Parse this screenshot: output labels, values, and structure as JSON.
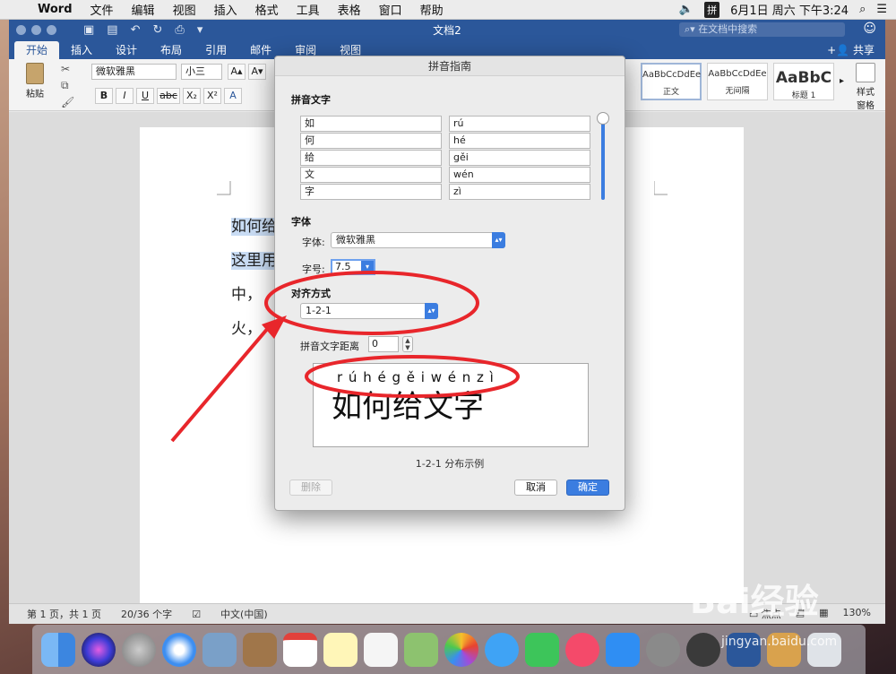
{
  "menubar": {
    "app": "Word",
    "items": [
      "文件",
      "编辑",
      "视图",
      "插入",
      "格式",
      "工具",
      "表格",
      "窗口",
      "帮助"
    ],
    "ime": "拼",
    "clock": "6月1日 周六 下午3:24"
  },
  "window": {
    "title": "文档2",
    "search_placeholder": "在文档中搜索",
    "share": "共享"
  },
  "tabs": [
    "开始",
    "插入",
    "设计",
    "布局",
    "引用",
    "邮件",
    "审阅",
    "视图"
  ],
  "ribbon": {
    "paste": "粘贴",
    "font": "微软雅黑",
    "size": "小三",
    "format_buttons": [
      "B",
      "I",
      "U",
      "abc",
      "X₂",
      "X²"
    ],
    "styles": [
      {
        "sample": "AaBbCcDdEe",
        "name": "正文"
      },
      {
        "sample": "AaBbCcDdEe",
        "name": "无间隔"
      },
      {
        "sample": "AaBbC",
        "name": "标题 1"
      }
    ],
    "style_pane": "样式\n窗格"
  },
  "document": {
    "lines": [
      "如何给",
      "这里用",
      "中，",
      "火，"
    ]
  },
  "statusbar": {
    "page": "第 1 页，共 1 页",
    "words": "20/36 个字",
    "lang": "中文(中国)",
    "focus": "焦点",
    "zoom": "130%"
  },
  "dialog": {
    "title": "拼音指南",
    "section_text": "拼音文字",
    "rows": [
      {
        "char": "如",
        "pinyin": "rú"
      },
      {
        "char": "何",
        "pinyin": "hé"
      },
      {
        "char": "给",
        "pinyin": "gěi"
      },
      {
        "char": "文",
        "pinyin": "wén"
      },
      {
        "char": "字",
        "pinyin": "zì"
      }
    ],
    "section_font": "字体",
    "font_label": "字体:",
    "font_value": "微软雅黑",
    "size_label": "字号:",
    "size_value": "7.5",
    "align_label": "对齐方式",
    "align_value": "1-2-1",
    "distance_label": "拼音文字距离",
    "distance_value": "0",
    "preview_pinyin": "r ú h é g ě i w é n z ì",
    "preview_text": "如何给文字",
    "caption": "1-2-1 分布示例",
    "delete": "删除",
    "cancel": "取消",
    "ok": "确定"
  },
  "watermark": {
    "brand": "Bai经验",
    "url": "jingyan.baidu.com"
  },
  "colors": {
    "word_blue": "#2b579a",
    "accent": "#3b7de0",
    "annotation_red": "#e8262b"
  }
}
